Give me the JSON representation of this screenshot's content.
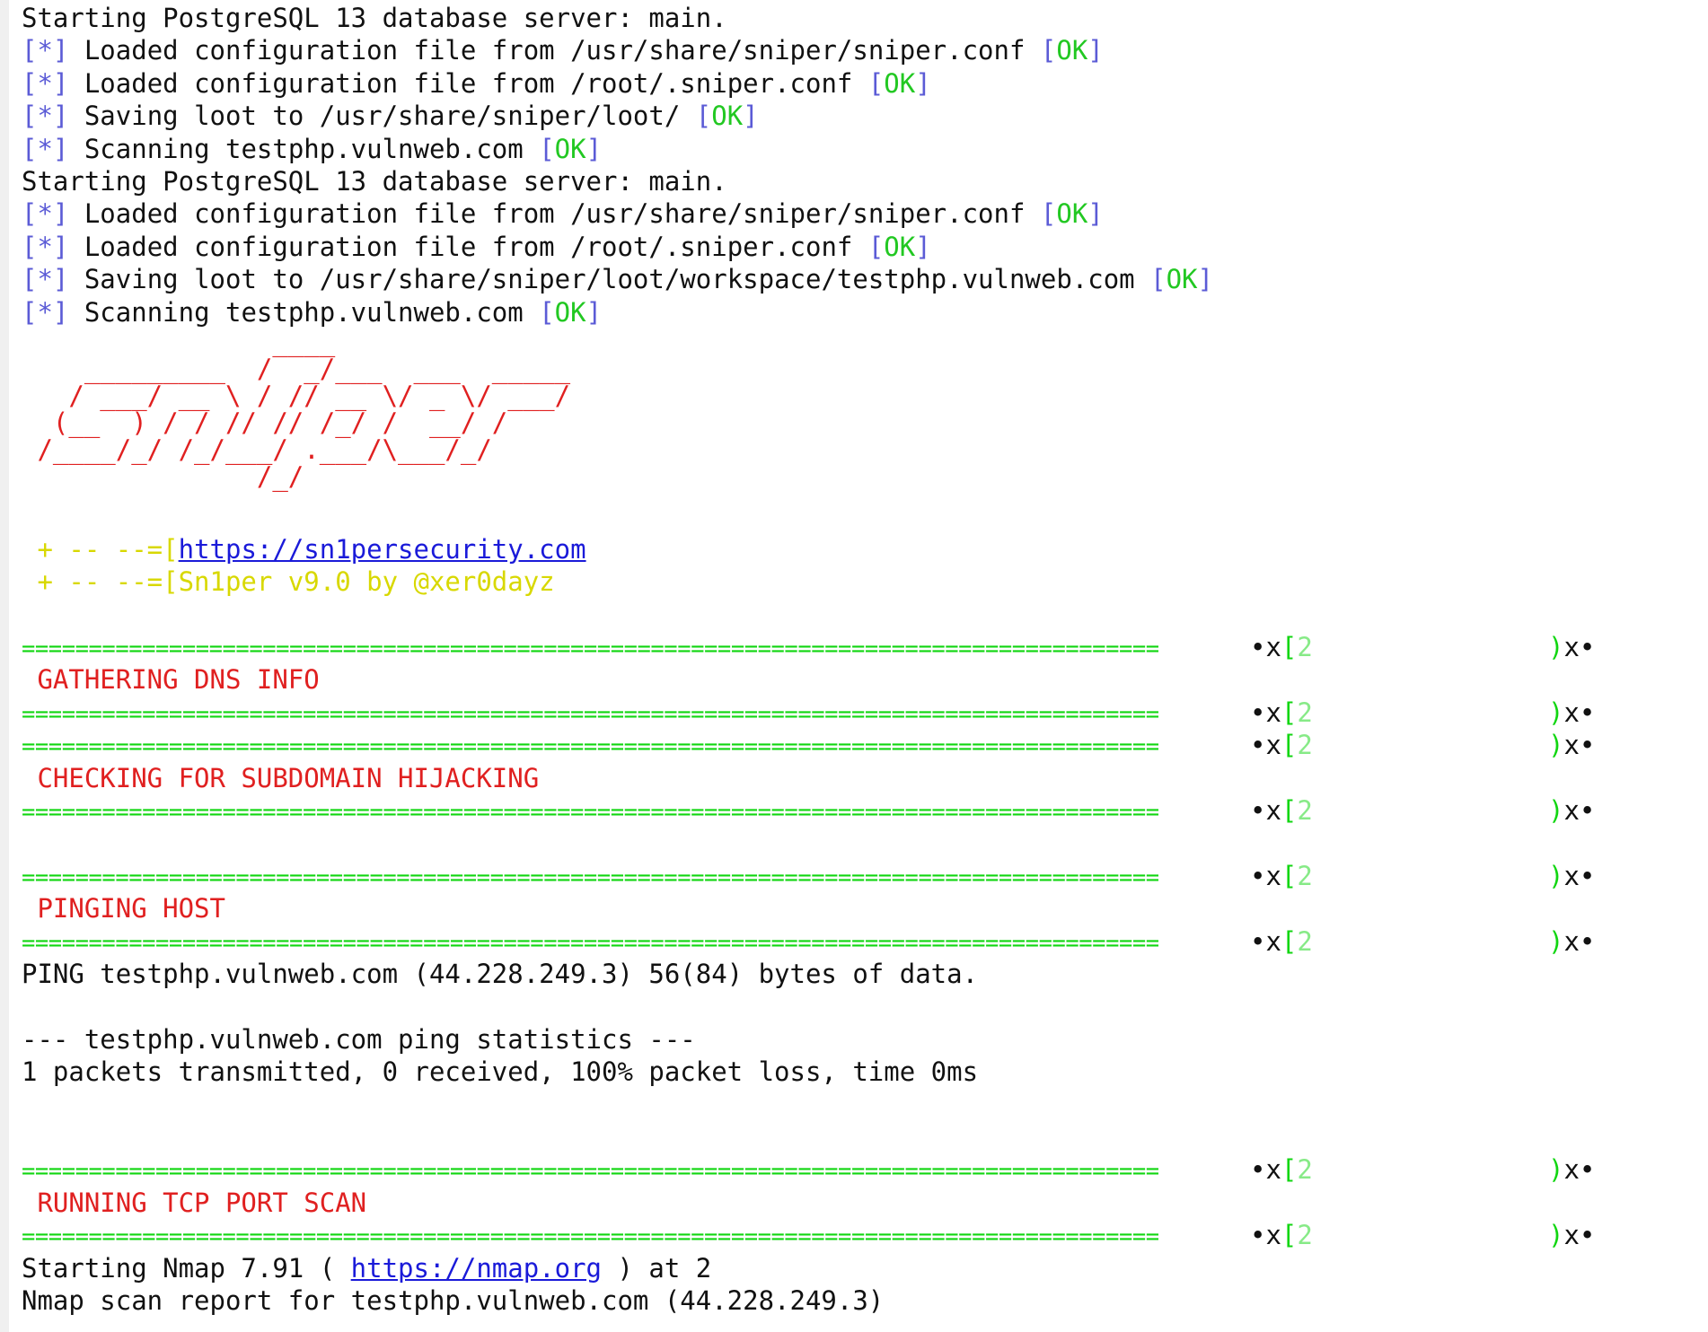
{
  "colors": {
    "bracket": "#5b5bd6",
    "ok": "#22c822",
    "heading": "#e02020",
    "banner": "#d8d800",
    "separator": "#11d611",
    "link": "#1a1ad9",
    "text": "#111111"
  },
  "status_lines_1": [
    {
      "prefix": "[*]",
      "text": " Loaded configuration file from /usr/share/sniper/sniper.conf ",
      "status": "[OK]"
    },
    {
      "prefix": "[*]",
      "text": " Loaded configuration file from /root/.sniper.conf ",
      "status": "[OK]"
    },
    {
      "prefix": "[*]",
      "text": " Saving loot to /usr/share/sniper/loot/ ",
      "status": "[OK]"
    },
    {
      "prefix": "[*]",
      "text": " Scanning testphp.vulnweb.com ",
      "status": "[OK]"
    }
  ],
  "status_lines_2": [
    {
      "prefix": "[*]",
      "text": " Loaded configuration file from /usr/share/sniper/sniper.conf ",
      "status": "[OK]"
    },
    {
      "prefix": "[*]",
      "text": " Loaded configuration file from /root/.sniper.conf ",
      "status": "[OK]"
    },
    {
      "prefix": "[*]",
      "text": " Saving loot to /usr/share/sniper/loot/workspace/testphp.vulnweb.com ",
      "status": "[OK]"
    },
    {
      "prefix": "[*]",
      "text": " Scanning testphp.vulnweb.com ",
      "status": "[OK]"
    }
  ],
  "postgres_line": "Starting PostgreSQL 13 database server: main.",
  "logo_art": [
    "                ____",
    "    _________  /  _/___  ___  _____",
    "   / ___/ __ \\ / // __ \\/ _ \\/ ___/",
    "  (__  ) / / // // /_/ /  __/ /",
    " /____/_/ /_/___/ .___/\\___/_/",
    "               /_/"
  ],
  "banner": {
    "line1_prefix": " + -- --=[",
    "line1_link": "https://sn1persecurity.com",
    "line2": " + -- --=[Sn1per v9.0 by @xer0dayz"
  },
  "separator": {
    "rule": "=====================================================================================",
    "mid": "•x[",
    "cut": "2",
    "end": ")x•"
  },
  "sections": {
    "dns": " GATHERING DNS INFO",
    "subdomain": " CHECKING FOR SUBDOMAIN HIJACKING",
    "ping": " PINGING HOST",
    "tcp": " RUNNING TCP PORT SCAN"
  },
  "ping_output": {
    "line1": "PING testphp.vulnweb.com (44.228.249.3) 56(84) bytes of data.",
    "line2": "--- testphp.vulnweb.com ping statistics ---",
    "line3": "1 packets transmitted, 0 received, 100% packet loss, time 0ms"
  },
  "nmap_output": {
    "line1_prefix": "Starting Nmap 7.91 ( ",
    "line1_link": "https://nmap.org",
    "line1_suffix": " ) at 2",
    "line2": "Nmap scan report for testphp.vulnweb.com (44.228.249.3)"
  }
}
